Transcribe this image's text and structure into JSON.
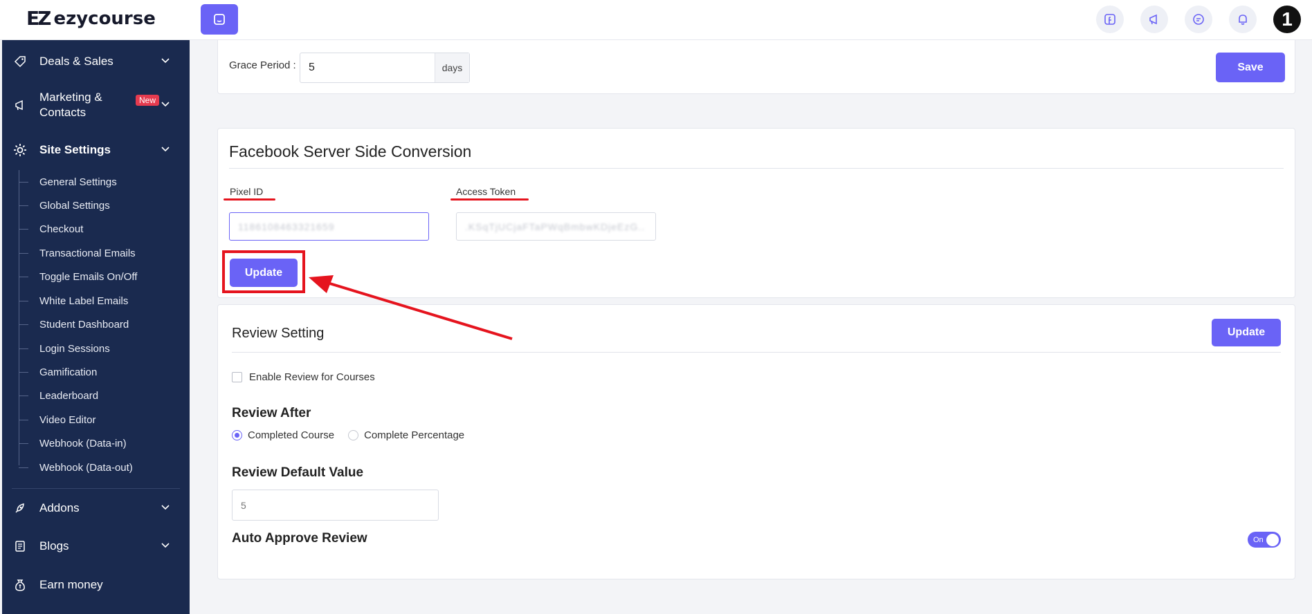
{
  "brand": {
    "name": "ezycourse"
  },
  "colors": {
    "accent": "#6a63f6",
    "sidebar_bg": "#1a2a4f",
    "annotation_red": "#e5141e",
    "badge_red": "#e53b4f"
  },
  "topbar": {
    "app_button_icon": "app-switch-icon",
    "icons": [
      "facebook-icon",
      "megaphone-icon",
      "chat-icon",
      "bell-icon"
    ],
    "avatar_text": "1"
  },
  "sidebar": {
    "deals": {
      "label": "Deals & Sales"
    },
    "marketing": {
      "label": "Marketing & Contacts",
      "badge": "New"
    },
    "site_settings": {
      "label": "Site Settings"
    },
    "sub_items": [
      "General Settings",
      "Global Settings",
      "Checkout",
      "Transactional Emails",
      "Toggle Emails On/Off",
      "White Label Emails",
      "Student Dashboard",
      "Login Sessions",
      "Gamification",
      "Leaderboard",
      "Video Editor",
      "Webhook (Data-in)",
      "Webhook (Data-out)"
    ],
    "addons": {
      "label": "Addons"
    },
    "blogs": {
      "label": "Blogs"
    },
    "earn": {
      "label": "Earn money"
    }
  },
  "grace": {
    "label": "Grace Period :",
    "value": "5",
    "suffix": "days",
    "save_label": "Save"
  },
  "fb": {
    "title": "Facebook Server Side Conversion",
    "pixel_label": "Pixel ID",
    "pixel_value": "1186108463321659",
    "token_label": "Access Token",
    "token_value": ".KSqTjUCjaFTaPWqBmbwKDjeEzG..",
    "update_label": "Update"
  },
  "review": {
    "title": "Review Setting",
    "update_label": "Update",
    "enable_label": "Enable Review for Courses",
    "enable_checked": false,
    "after_title": "Review After",
    "after_options": [
      "Completed Course",
      "Complete Percentage"
    ],
    "after_selected": "Completed Course",
    "default_title": "Review Default Value",
    "default_value": "5",
    "auto_title": "Auto Approve Review",
    "auto_toggle_label": "On",
    "auto_toggle_on": true
  }
}
